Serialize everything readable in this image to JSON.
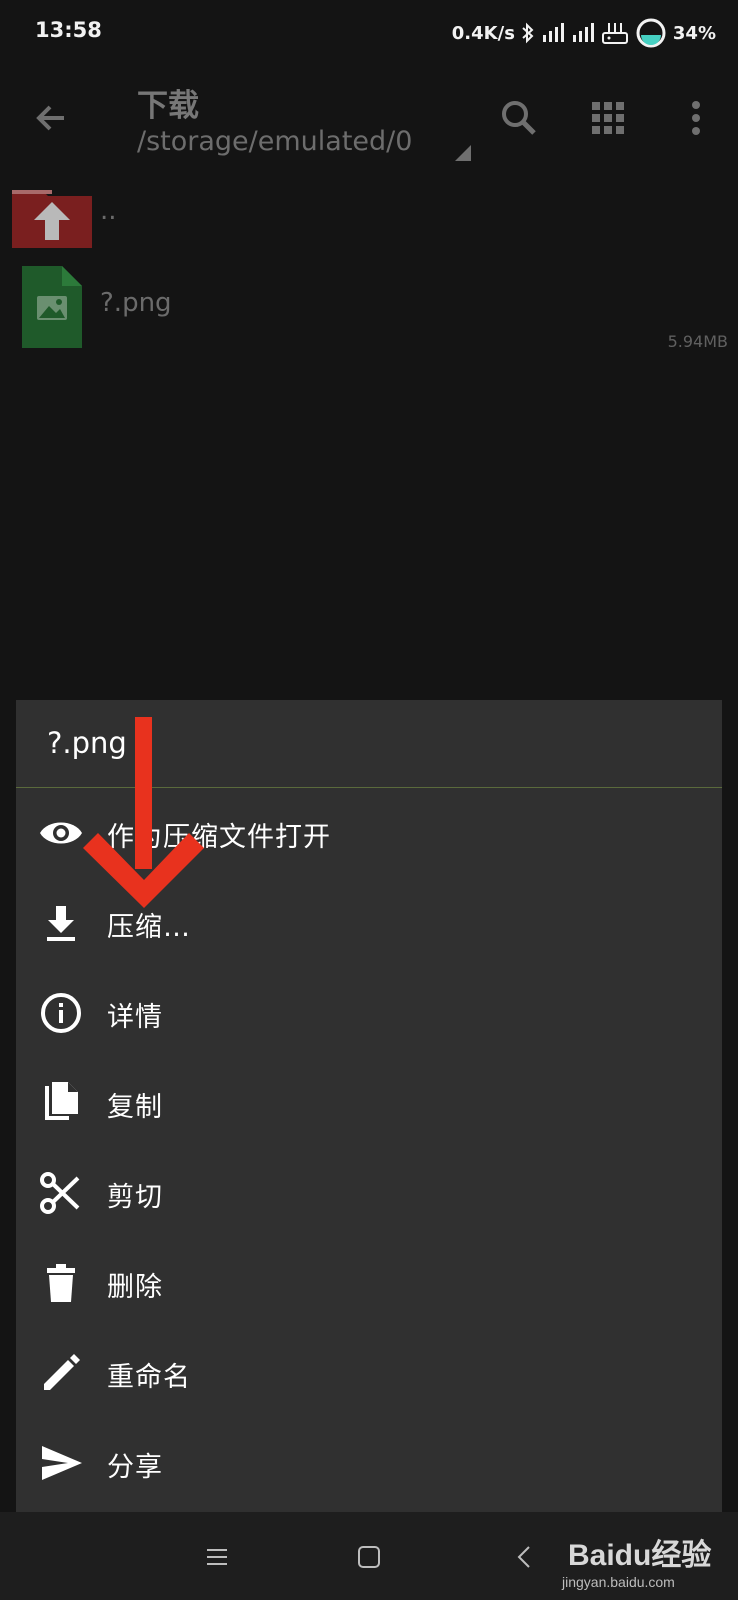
{
  "status_bar": {
    "time": "13:58",
    "net_speed": "0.4K/s",
    "battery": "34%",
    "icons": [
      "bluetooth-icon",
      "signal-icon",
      "signal-icon",
      "router-icon",
      "battery-icon"
    ]
  },
  "app_bar": {
    "title": "下载",
    "path": "/storage/emulated/0",
    "icons": [
      "back-arrow-icon",
      "search-icon",
      "grid-view-icon",
      "more-vert-icon"
    ]
  },
  "files": [
    {
      "name": "..",
      "icon": "folder-up-icon",
      "color": "#7a1f1f"
    },
    {
      "name": "?.png",
      "size": "5.94MB",
      "icon": "image-file-icon",
      "color": "#1f5a2a"
    }
  ],
  "sheet": {
    "title": "?.png",
    "items": [
      {
        "label": "作为压缩文件打开",
        "icon": "eye-icon"
      },
      {
        "label": "压缩…",
        "icon": "download-icon"
      },
      {
        "label": "详情",
        "icon": "info-icon"
      },
      {
        "label": "复制",
        "icon": "copy-icon"
      },
      {
        "label": "剪切",
        "icon": "scissors-icon"
      },
      {
        "label": "删除",
        "icon": "trash-icon"
      },
      {
        "label": "重命名",
        "icon": "pencil-icon"
      },
      {
        "label": "分享",
        "icon": "send-icon"
      }
    ]
  },
  "nav_bar": {
    "icons": [
      "menu-icon",
      "home-square-icon",
      "back-chevron-icon"
    ]
  },
  "watermark": {
    "brand": "Baidu经验",
    "url": "jingyan.baidu.com"
  },
  "colors": {
    "annotation_arrow": "#e8321e",
    "background": "#141414",
    "sheet": "#303030"
  }
}
